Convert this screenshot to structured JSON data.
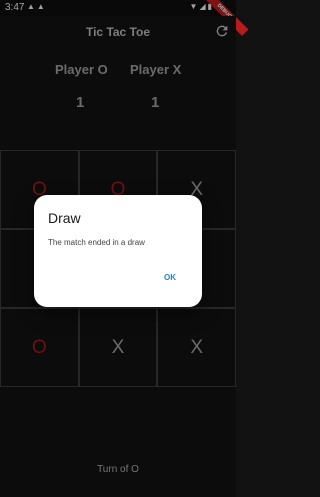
{
  "status_bar": {
    "time": "3:47",
    "left_icons": [
      "notification-icon",
      "notification-icon"
    ],
    "right_icons": [
      "wifi-icon",
      "signal-icon",
      "battery-icon"
    ]
  },
  "debug_banner": "DEBUG",
  "app_bar": {
    "title": "Tic Tac Toe",
    "refresh_icon": "refresh-icon"
  },
  "scoreboard": {
    "player_o": {
      "label": "Player O",
      "score": "1"
    },
    "player_x": {
      "label": "Player X",
      "score": "1"
    }
  },
  "board": {
    "cells": [
      "O",
      "O",
      "X",
      "",
      "",
      "",
      "O",
      "X",
      "X"
    ],
    "colors": {
      "o": "#9b1b1b",
      "x": "#9a9a9a"
    }
  },
  "turn_text": "Turn of O",
  "dialog": {
    "title": "Draw",
    "message": "The match ended in a draw",
    "ok_label": "OK",
    "accent": "#1e88c8"
  }
}
